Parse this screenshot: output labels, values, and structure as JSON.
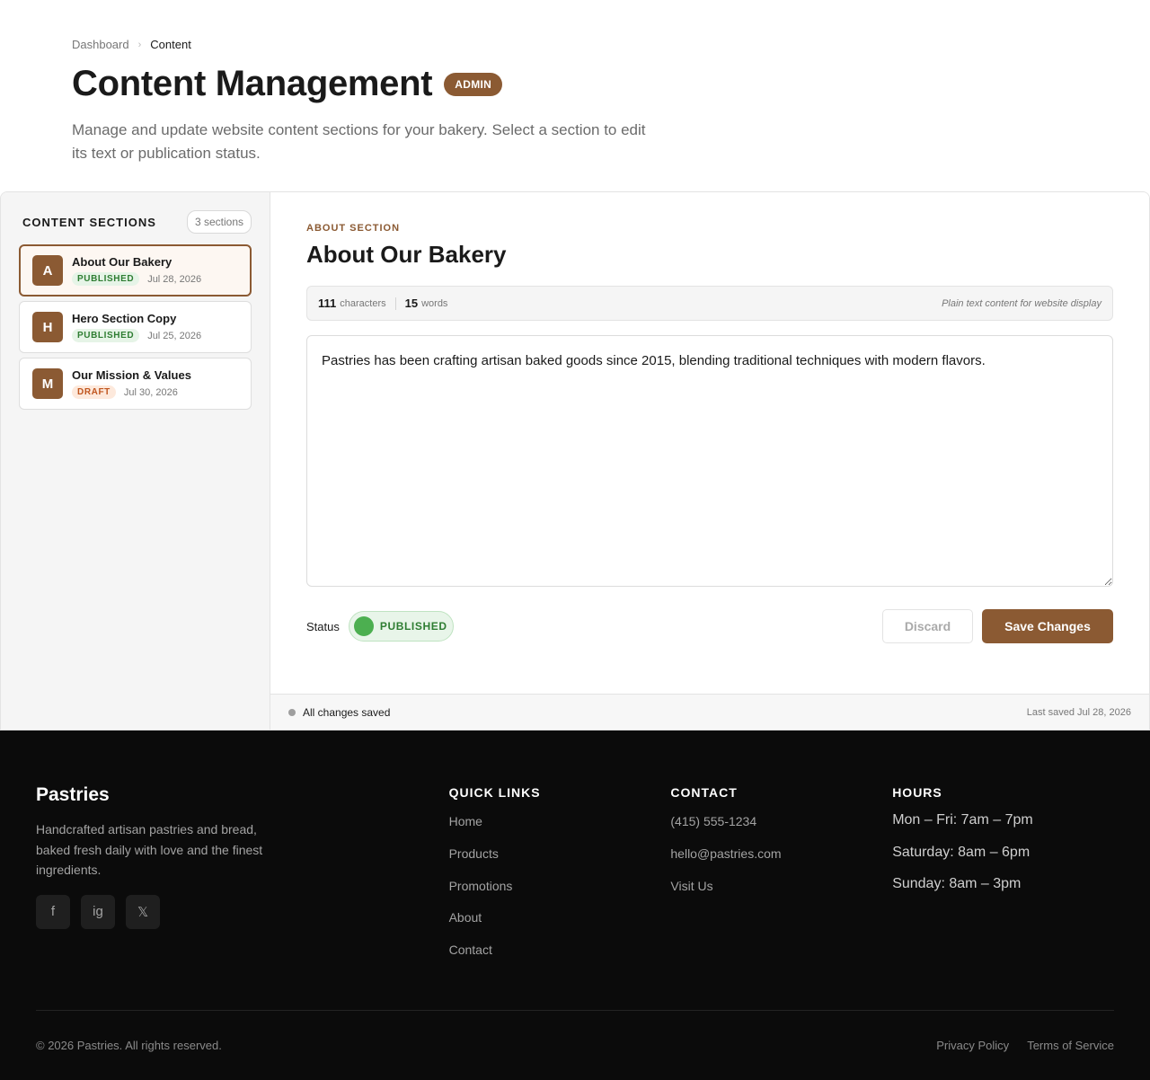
{
  "breadcrumb": {
    "items": [
      "Dashboard",
      "Content"
    ],
    "separator": "›"
  },
  "header": {
    "title": "Content Management",
    "badge": "ADMIN",
    "description": "Manage and update website content sections for your bakery. Select a section to edit its text or publication status."
  },
  "sidebar": {
    "title": "CONTENT SECTIONS",
    "count": "3 sections",
    "items": [
      {
        "initial": "A",
        "title": "About Our Bakery",
        "status": "PUBLISHED",
        "date": "Jul 28, 2026",
        "active": true
      },
      {
        "initial": "H",
        "title": "Hero Section Copy",
        "status": "PUBLISHED",
        "date": "Jul 25, 2026",
        "active": false
      },
      {
        "initial": "M",
        "title": "Our Mission & Values",
        "status": "DRAFT",
        "date": "Jul 30, 2026",
        "active": false
      }
    ]
  },
  "editor": {
    "eyebrow": "ABOUT SECTION",
    "title": "About Our Bakery",
    "stats": {
      "characters": "111",
      "characters_label": "characters",
      "words": "15",
      "words_label": "words",
      "hint": "Plain text content for website display"
    },
    "content": "Pastries has been crafting artisan baked goods since 2015, blending traditional techniques with modern flavors.",
    "status_label": "Status",
    "status_value": "PUBLISHED",
    "discard_label": "Discard",
    "save_label": "Save Changes",
    "save_status": "All changes saved",
    "last_saved": "Last saved Jul 28, 2026"
  },
  "footer": {
    "brand": "Pastries",
    "brand_desc": "Handcrafted artisan pastries and bread, baked fresh daily with love and the finest ingredients.",
    "socials": [
      "f",
      "ig",
      "𝕏"
    ],
    "quick_links": {
      "title": "QUICK LINKS",
      "items": [
        "Home",
        "Products",
        "Promotions",
        "About",
        "Contact"
      ]
    },
    "contact": {
      "title": "CONTACT",
      "items": [
        "(415) 555-1234",
        "hello@pastries.com",
        "Visit Us"
      ]
    },
    "hours": {
      "title": "HOURS",
      "items": [
        "Mon – Fri: 7am – 7pm",
        "Saturday: 8am – 6pm",
        "Sunday: 8am – 3pm"
      ]
    },
    "copyright": "© 2026 Pastries. All rights reserved.",
    "legal": [
      "Privacy Policy",
      "Terms of Service"
    ]
  },
  "colors": {
    "accent": "#8b5a33",
    "published": "#2e7d32",
    "draft": "#c0551e",
    "footer_bg": "#0b0b0b"
  }
}
